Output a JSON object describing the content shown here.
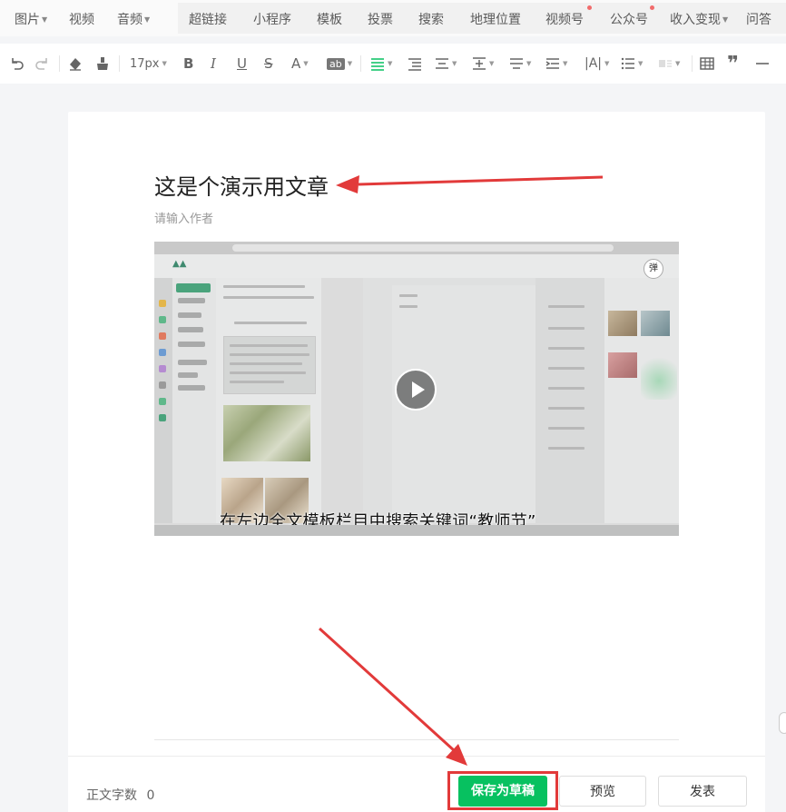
{
  "menubar": {
    "media": [
      {
        "label": "图片",
        "has_menu": true
      },
      {
        "label": "视频",
        "has_menu": false
      },
      {
        "label": "音频",
        "has_menu": true
      }
    ],
    "insert": [
      {
        "label": "超链接"
      },
      {
        "label": "小程序"
      },
      {
        "label": "模板"
      },
      {
        "label": "投票"
      },
      {
        "label": "搜索"
      },
      {
        "label": "地理位置"
      },
      {
        "label": "视频号"
      },
      {
        "label": "公众号"
      },
      {
        "label": "收入变现"
      },
      {
        "label": "问答"
      }
    ]
  },
  "toolbar": {
    "font_size": "17px",
    "icons": [
      "undo-icon",
      "redo-icon",
      "clear-format-icon",
      "format-brush-icon",
      "bold-icon",
      "italic-icon",
      "underline-icon",
      "strikethrough-icon",
      "font-color-icon",
      "highlight-color-icon",
      "align-icon",
      "indent-icon",
      "paragraph-spacing-icon",
      "line-height-icon",
      "letter-spacing-icon",
      "list-icon",
      "table-icon",
      "quote-icon",
      "divider-icon"
    ]
  },
  "article": {
    "title": "这是个演示用文章",
    "author_placeholder": "请输入作者",
    "video": {
      "subtitle": "在左边全文模板栏目中搜索关键词“教师节”",
      "badge": "弹"
    }
  },
  "footer": {
    "word_count_label": "正文字数",
    "word_count": "0",
    "save_label": "保存为草稿",
    "preview_label": "预览",
    "publish_label": "发表"
  },
  "colors": {
    "primary": "#07c160",
    "annotation": "#e23a3a"
  }
}
